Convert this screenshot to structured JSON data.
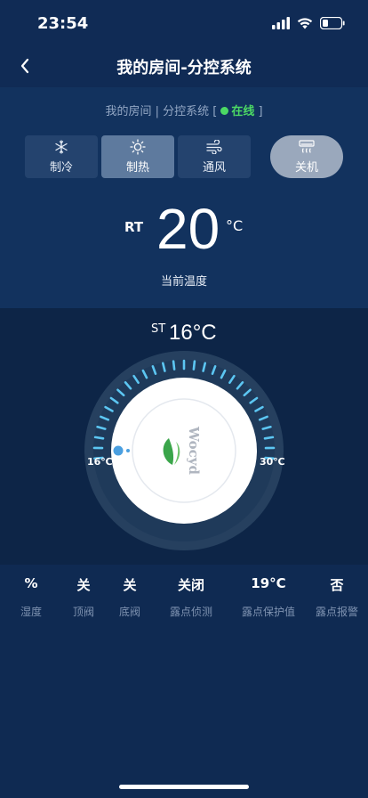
{
  "status_bar": {
    "time": "23:54"
  },
  "nav": {
    "title": "我的房间-分控系统"
  },
  "breadcrumb": {
    "path": "我的房间 | 分控系统 [",
    "status": "在线",
    "close": "]"
  },
  "modes": [
    {
      "label": "制冷",
      "icon": "snowflake-icon"
    },
    {
      "label": "制热",
      "icon": "sun-icon",
      "active": true
    },
    {
      "label": "通风",
      "icon": "wind-icon"
    }
  ],
  "power": {
    "label": "关机",
    "icon": "air-conditioner-icon"
  },
  "room_temp": {
    "label": "RT",
    "value": "20",
    "unit": "°C",
    "caption": "当前温度"
  },
  "set_temp": {
    "label": "ST",
    "value": "16°C"
  },
  "dial": {
    "min_label": "16℃",
    "max_label": "30℃",
    "min": 16,
    "max": 30,
    "current": 16,
    "brand": "Wocyd",
    "logo_color": "#3aa54a",
    "active_tick_color": "#5cc6f2"
  },
  "info": [
    {
      "value": "%",
      "label": "湿度"
    },
    {
      "value": "关",
      "label": "顶阀"
    },
    {
      "value": "关",
      "label": "底阀"
    },
    {
      "value": "关闭",
      "label": "露点侦测"
    },
    {
      "value": "19°C",
      "label": "露点保护值"
    },
    {
      "value": "否",
      "label": "露点报警"
    }
  ]
}
